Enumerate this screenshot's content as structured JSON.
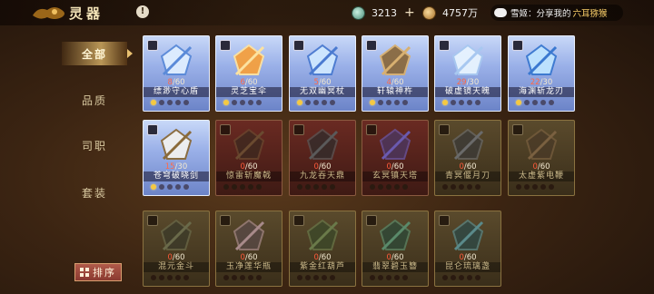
{
  "header": {
    "title": "灵器",
    "info_badge": "!",
    "currency_jade": "3213",
    "currency_gold": "4757万",
    "plus": "+",
    "chat_prefix": "雪姬：分享我的",
    "chat_link": "六耳猕猴"
  },
  "sidebar": {
    "items": [
      {
        "label": "全部",
        "active": true
      },
      {
        "label": "品质",
        "active": false
      },
      {
        "label": "司职",
        "active": false
      },
      {
        "label": "套装",
        "active": false
      }
    ],
    "sort_label": "排序"
  },
  "cards": [
    {
      "name": "缥渺守心盾",
      "cur": "8",
      "max": "/60",
      "style": "unlocked-blue",
      "stars": 1,
      "icon": "shield-icon"
    },
    {
      "name": "灵芝宝伞",
      "cur": "6",
      "max": "/60",
      "style": "unlocked-blue",
      "stars": 1,
      "icon": "mushroom-umbrella-icon"
    },
    {
      "name": "无双幽冥杖",
      "cur": "5",
      "max": "/60",
      "style": "unlocked-blue",
      "stars": 1,
      "icon": "staff-icon"
    },
    {
      "name": "轩辕神杵",
      "cur": "4",
      "max": "/60",
      "style": "unlocked-blue",
      "stars": 1,
      "icon": "pestle-icon"
    },
    {
      "name": "破虚镜天魄",
      "cur": "29",
      "max": "/30",
      "style": "unlocked-blue",
      "stars": 1,
      "icon": "mirror-icon"
    },
    {
      "name": "海渊斩龙刃",
      "cur": "22",
      "max": "/30",
      "style": "unlocked-blue",
      "stars": 1,
      "icon": "blade-icon"
    },
    {
      "name": "苍穹破晓剑",
      "cur": "15",
      "max": "/30",
      "style": "unlocked-blue",
      "stars": 1,
      "icon": "sword-icon"
    },
    {
      "name": "惊雷斩魔戟",
      "cur": "0",
      "max": "/60",
      "style": "locked-red",
      "stars": 0,
      "icon": "halberd-icon"
    },
    {
      "name": "九龙吞天鼎",
      "cur": "0",
      "max": "/60",
      "style": "locked-red",
      "stars": 0,
      "icon": "cauldron-icon"
    },
    {
      "name": "玄冥镇天塔",
      "cur": "0",
      "max": "/60",
      "style": "locked-red",
      "stars": 0,
      "icon": "crystal-icon"
    },
    {
      "name": "青冥偃月刀",
      "cur": "0",
      "max": "/60",
      "style": "locked-gold",
      "stars": 0,
      "icon": "glaive-icon"
    },
    {
      "name": "太虚紫电鞭",
      "cur": "0",
      "max": "/60",
      "style": "locked-gold",
      "stars": 0,
      "icon": "whip-icon"
    },
    {
      "name": "混元金斗",
      "cur": "0",
      "max": "/60",
      "style": "locked-gold",
      "stars": 0,
      "icon": "spear-icon"
    },
    {
      "name": "玉净莲华瓶",
      "cur": "0",
      "max": "/60",
      "style": "locked-gold",
      "stars": 0,
      "icon": "lotus-icon"
    },
    {
      "name": "紫金红葫芦",
      "cur": "0",
      "max": "/60",
      "style": "locked-gold",
      "stars": 0,
      "icon": "basket-icon"
    },
    {
      "name": "翡翠碧玉簪",
      "cur": "0",
      "max": "/60",
      "style": "locked-gold",
      "stars": 0,
      "icon": "flute-icon"
    },
    {
      "name": "昆仑琉璃盏",
      "cur": "0",
      "max": "/60",
      "style": "locked-gold",
      "stars": 0,
      "icon": "vase-icon"
    }
  ]
}
